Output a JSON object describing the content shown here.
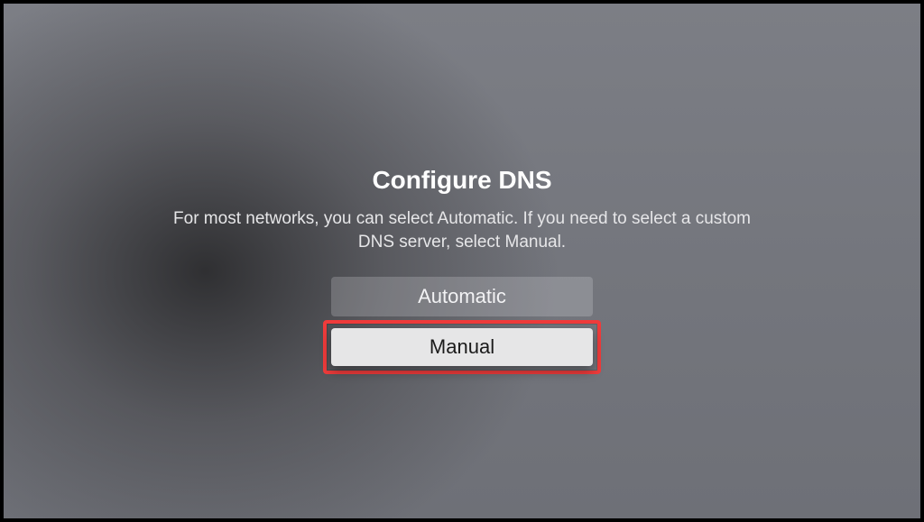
{
  "dialog": {
    "title": "Configure DNS",
    "subtitle": "For most networks, you can select Automatic. If you need to select a custom DNS server, select Manual.",
    "options": {
      "automatic": "Automatic",
      "manual": "Manual"
    }
  },
  "colors": {
    "highlight": "#ef3b3b"
  }
}
